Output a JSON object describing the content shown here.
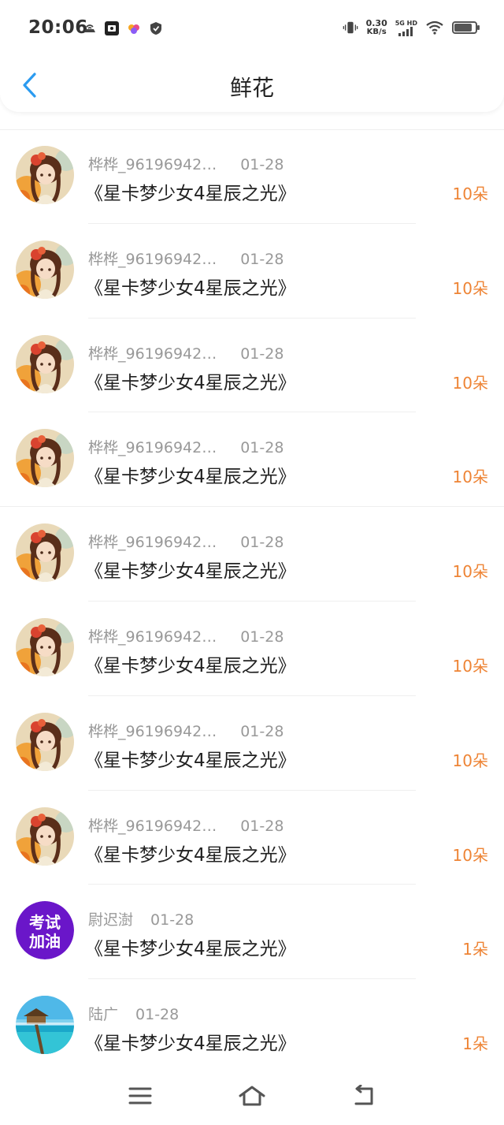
{
  "status_bar": {
    "time": "20:06",
    "net_speed_value": "0.30",
    "net_speed_unit": "KB/s",
    "network_type": "5G HD",
    "battery_level": 0.85,
    "icons_left": [
      "wireless-debug-icon",
      "app-notification-icon",
      "color-app-icon",
      "shield-icon"
    ],
    "icons_right": [
      "vibrate-icon",
      "signal-icon",
      "wifi-icon",
      "battery-icon"
    ]
  },
  "header": {
    "title": "鲜花",
    "back_icon": "chevron-left-icon"
  },
  "colors": {
    "accent_blue": "#2b9bf0",
    "amount_orange": "#ee8435",
    "meta_gray": "#999999"
  },
  "list": {
    "items": [
      {
        "user": "桦桦_96196942…",
        "date": "01-28",
        "title": "《星卡梦少女4星辰之光》",
        "amount": "10朵",
        "avatar": "girl-portrait-avatar"
      },
      {
        "user": "桦桦_96196942…",
        "date": "01-28",
        "title": "《星卡梦少女4星辰之光》",
        "amount": "10朵",
        "avatar": "girl-portrait-avatar"
      },
      {
        "user": "桦桦_96196942…",
        "date": "01-28",
        "title": "《星卡梦少女4星辰之光》",
        "amount": "10朵",
        "avatar": "girl-portrait-avatar"
      },
      {
        "user": "桦桦_96196942…",
        "date": "01-28",
        "title": "《星卡梦少女4星辰之光》",
        "amount": "10朵",
        "avatar": "girl-portrait-avatar"
      },
      {
        "user": "桦桦_96196942…",
        "date": "01-28",
        "title": "《星卡梦少女4星辰之光》",
        "amount": "10朵",
        "avatar": "girl-portrait-avatar"
      },
      {
        "user": "桦桦_96196942…",
        "date": "01-28",
        "title": "《星卡梦少女4星辰之光》",
        "amount": "10朵",
        "avatar": "girl-portrait-avatar"
      },
      {
        "user": "桦桦_96196942…",
        "date": "01-28",
        "title": "《星卡梦少女4星辰之光》",
        "amount": "10朵",
        "avatar": "girl-portrait-avatar"
      },
      {
        "user": "桦桦_96196942…",
        "date": "01-28",
        "title": "《星卡梦少女4星辰之光》",
        "amount": "10朵",
        "avatar": "girl-portrait-avatar"
      },
      {
        "user": "尉迟澍",
        "date": "01-28",
        "title": "《星卡梦少女4星辰之光》",
        "amount": "1朵",
        "avatar": "exam-cheer-avatar",
        "avatar_text_1": "考试",
        "avatar_text_2": "加油"
      },
      {
        "user": "陆广",
        "date": "01-28",
        "title": "《星卡梦少女4星辰之光》",
        "amount": "1朵",
        "avatar": "beach-pier-avatar"
      }
    ]
  },
  "nav_bar": {
    "buttons": [
      "menu-icon",
      "home-icon",
      "back-icon"
    ]
  }
}
